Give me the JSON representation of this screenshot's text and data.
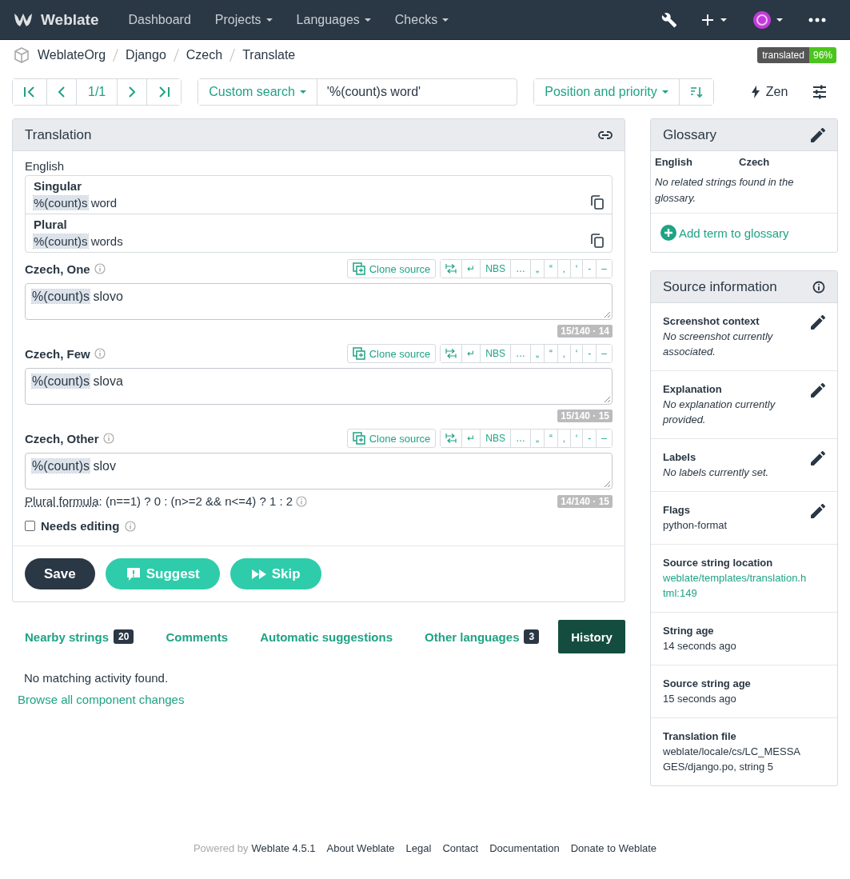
{
  "navbar": {
    "brand": "Weblate",
    "menu": [
      {
        "label": "Dashboard",
        "dropdown": false
      },
      {
        "label": "Projects",
        "dropdown": true
      },
      {
        "label": "Languages",
        "dropdown": true
      },
      {
        "label": "Checks",
        "dropdown": true
      }
    ]
  },
  "breadcrumbs": [
    "WeblateOrg",
    "Django",
    "Czech",
    "Translate"
  ],
  "progress": {
    "label": "translated",
    "value": "96%"
  },
  "pager": {
    "position": "1/1"
  },
  "search": {
    "filter": "Custom search",
    "value": "'%(count)s word'"
  },
  "sort": {
    "label": "Position and priority"
  },
  "zen": {
    "label": "Zen"
  },
  "translation": {
    "title": "Translation",
    "source_language": "English",
    "sources": [
      {
        "label": "Singular",
        "segments": [
          {
            "text": "%(count)s",
            "kind": "placeable"
          },
          {
            "text": " word",
            "kind": "plain"
          }
        ]
      },
      {
        "label": "Plural",
        "segments": [
          {
            "text": "%(count)s",
            "kind": "placeable"
          },
          {
            "text": " words",
            "kind": "plain"
          }
        ]
      }
    ],
    "plurals": [
      {
        "label": "Czech, One",
        "clone": "Clone source",
        "chars": [
          "↵",
          "NBS",
          "…",
          "„",
          "“",
          "‚",
          "‘",
          "-",
          "–"
        ],
        "segments": [
          {
            "text": "%(count)s",
            "kind": "placeable"
          },
          {
            "text": " slovo",
            "kind": "plain"
          }
        ],
        "counter": "15/140 · 14"
      },
      {
        "label": "Czech, Few",
        "clone": "Clone source",
        "chars": [
          "↵",
          "NBS",
          "…",
          "„",
          "“",
          "‚",
          "‘",
          "-",
          "–"
        ],
        "segments": [
          {
            "text": "%(count)s",
            "kind": "placeable"
          },
          {
            "text": " slova",
            "kind": "plain"
          }
        ],
        "counter": "15/140 · 15"
      },
      {
        "label": "Czech, Other",
        "clone": "Clone source",
        "chars": [
          "↵",
          "NBS",
          "…",
          "„",
          "“",
          "‚",
          "‘",
          "-",
          "–"
        ],
        "segments": [
          {
            "text": "%(count)s",
            "kind": "placeable"
          },
          {
            "text": " slov",
            "kind": "plain"
          }
        ],
        "counter": "14/140 · 15"
      }
    ],
    "plural_formula": {
      "label": "Plural formula",
      "text": ": (n==1) ? 0 : (n>=2 && n<=4) ? 1 : 2"
    },
    "needs_editing": {
      "label": "Needs editing",
      "checked": false
    },
    "buttons": [
      {
        "label": "Save",
        "kind": "save"
      },
      {
        "label": "Suggest",
        "kind": "suggest"
      },
      {
        "label": "Skip",
        "kind": "skip"
      }
    ]
  },
  "tabs": [
    {
      "label": "Nearby strings",
      "count": "20",
      "selected": false
    },
    {
      "label": "Comments",
      "selected": false
    },
    {
      "label": "Automatic suggestions",
      "selected": false
    },
    {
      "label": "Other languages",
      "count": "3",
      "selected": false
    },
    {
      "label": "History",
      "selected": true
    }
  ],
  "history": {
    "empty": "No matching activity found.",
    "link": "Browse all component changes"
  },
  "glossary": {
    "title": "Glossary",
    "columns": [
      "English",
      "Czech"
    ],
    "empty": "No related strings found in the glossary.",
    "add": "Add term to glossary"
  },
  "source_info": {
    "title": "Source information",
    "items": [
      {
        "label": "Screenshot context",
        "value": "No screenshot currently associated.",
        "kind": "note",
        "editable": true
      },
      {
        "label": "Explanation",
        "value": "No explanation currently provided.",
        "kind": "note",
        "editable": true
      },
      {
        "label": "Labels",
        "value": "No labels currently set.",
        "kind": "note",
        "editable": true
      },
      {
        "label": "Flags",
        "value": "python-format",
        "kind": "text",
        "editable": true
      },
      {
        "label": "Source string location",
        "value": "weblate/templates/translation.html:149",
        "kind": "link",
        "editable": false
      },
      {
        "label": "String age",
        "value": "14 seconds ago",
        "kind": "text",
        "editable": false
      },
      {
        "label": "Source string age",
        "value": "15 seconds ago",
        "kind": "text",
        "editable": false
      },
      {
        "label": "Translation file",
        "value": "weblate/locale/cs/LC_MESSAGES/django.po, string 5",
        "kind": "text",
        "editable": false
      }
    ]
  },
  "footer": {
    "powered": "Powered by",
    "links": [
      "Weblate 4.5.1",
      "About Weblate",
      "Legal",
      "Contact",
      "Documentation",
      "Donate to Weblate"
    ]
  }
}
